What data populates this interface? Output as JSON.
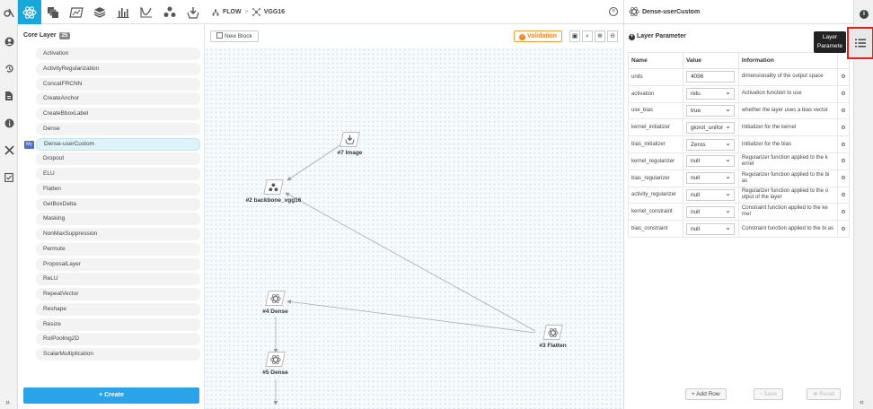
{
  "toolbar": {
    "icons": [
      "network-icon",
      "layers-stack-icon",
      "dataset-icon",
      "layers-icon",
      "bar-chart-icon",
      "curve-icon",
      "nodes-icon",
      "download-box-icon"
    ]
  },
  "layer_panel": {
    "title": "Core Layer",
    "count": "25",
    "my_tag": "My",
    "items": [
      {
        "label": "Activation"
      },
      {
        "label": "ActivityRegularization"
      },
      {
        "label": "ConcatFRCNN"
      },
      {
        "label": "CreateAnchor"
      },
      {
        "label": "CreateBboxLabel"
      },
      {
        "label": "Dense"
      },
      {
        "label": "Dense-userCustom"
      },
      {
        "label": "Dropout"
      },
      {
        "label": "ELU"
      },
      {
        "label": "Flatten"
      },
      {
        "label": "GetBoxDelta"
      },
      {
        "label": "Masking"
      },
      {
        "label": "NonMaxSuppression"
      },
      {
        "label": "Permute"
      },
      {
        "label": "ProposalLayer"
      },
      {
        "label": "ReLU"
      },
      {
        "label": "RepeatVector"
      },
      {
        "label": "Reshape"
      },
      {
        "label": "Resize"
      },
      {
        "label": "RoIPooling2D"
      },
      {
        "label": "ScalarMultiplication"
      }
    ],
    "create_label": "+ Create",
    "collapse_label": "»"
  },
  "canvas": {
    "crumb_root": "FLOW",
    "crumb_sep": ">",
    "crumb_current": "VGG16",
    "close_label": "×",
    "new_block_label": "New Block",
    "validation_label": "Validation",
    "nodes": {
      "image": "#7 Image",
      "backbone": "#2 backbone_vgg16",
      "dense4": "#4 Dense",
      "flatten": "#3 Flatten",
      "dense5": "#5 Dense"
    }
  },
  "param_panel": {
    "title": "Dense-userCustom",
    "section_title": "Layer Parameter",
    "headers": {
      "name": "Name",
      "value": "Value",
      "info": "Information"
    },
    "rows": [
      {
        "name": "units",
        "value": "4096",
        "info": "dimensionality of the output space"
      },
      {
        "name": "activation",
        "value": "relu",
        "info": "Activation function to use"
      },
      {
        "name": "use_bias",
        "value": "true",
        "info": "whether the layer uses a bias vector"
      },
      {
        "name": "kernel_initializer",
        "value": "glorot_unifor",
        "info": "Initializer for the kernel"
      },
      {
        "name": "bias_initializer",
        "value": "Zeros",
        "info": "Initializer for the bias"
      },
      {
        "name": "kernel_regularizer",
        "value": "null",
        "info": "Regularizer function applied to the k ernel"
      },
      {
        "name": "bias_regularizer",
        "value": "null",
        "info": "Regularizer function applied to the bi as"
      },
      {
        "name": "activity_regularizer",
        "value": "null",
        "info": "Regularizer function applied to the o utput of the layer"
      },
      {
        "name": "kernel_constraint",
        "value": "null",
        "info": "Constraint function applied to the ke rnel"
      },
      {
        "name": "bias_constraint",
        "value": "null",
        "info": "Constraint function applied to the bi as"
      }
    ],
    "add_row_label": "+ Add Row",
    "save_label": "Save",
    "reset_label": "Reset"
  },
  "right_rail": {
    "info_label": "i",
    "tooltip_line1": "Layer",
    "tooltip_line2": "Paramete",
    "collapse_label": "«"
  }
}
